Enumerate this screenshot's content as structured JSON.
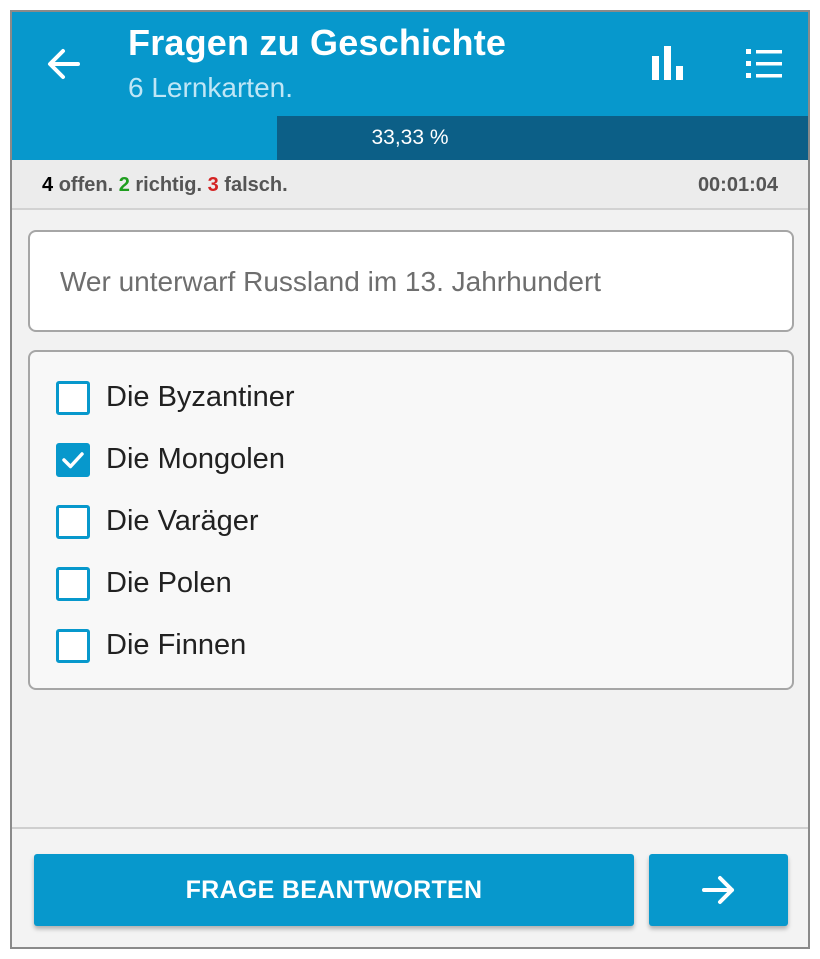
{
  "header": {
    "title": "Fragen zu Geschichte",
    "subtitle": "6 Lernkarten."
  },
  "progress": {
    "fraction": 0.3333,
    "label": "33,33 %"
  },
  "status": {
    "open_count": "4",
    "open_label": "offen.",
    "right_count": "2",
    "right_label": "richtig.",
    "wrong_count": "3",
    "wrong_label": "falsch.",
    "timer": "00:01:04"
  },
  "question": {
    "text": "Wer unterwarf Russland im 13. Jahrhundert"
  },
  "answers": [
    {
      "label": "Die Byzantiner",
      "checked": false
    },
    {
      "label": "Die Mongolen",
      "checked": true
    },
    {
      "label": "Die Varäger",
      "checked": false
    },
    {
      "label": "Die Polen",
      "checked": false
    },
    {
      "label": "Die Finnen",
      "checked": false
    }
  ],
  "footer": {
    "answer_button_label": "FRAGE BEANTWORTEN"
  },
  "icons": {
    "back": "arrow-left-icon",
    "stats": "bar-chart-icon",
    "menu": "list-icon",
    "next": "arrow-right-icon",
    "check": "check-icon"
  },
  "colors": {
    "primary": "#0798cc",
    "progress_track": "#0c5f87",
    "right": "#1f9e1f",
    "wrong": "#d42323"
  }
}
